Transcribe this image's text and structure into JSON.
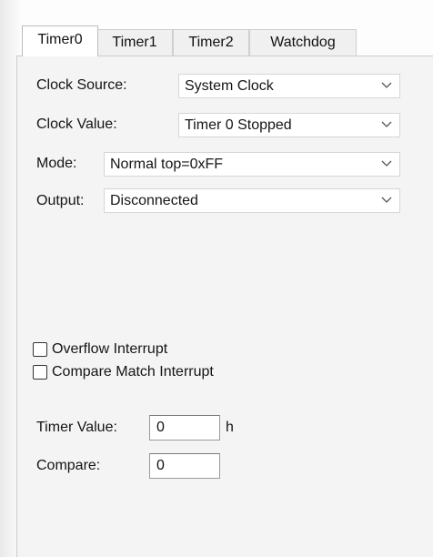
{
  "tabs": [
    {
      "label": "Timer0",
      "active": true
    },
    {
      "label": "Timer1",
      "active": false
    },
    {
      "label": "Timer2",
      "active": false
    },
    {
      "label": "Watchdog",
      "active": false
    }
  ],
  "clock_source": {
    "label": "Clock Source:",
    "value": "System Clock"
  },
  "clock_value": {
    "label": "Clock Value:",
    "value": "Timer 0 Stopped"
  },
  "mode": {
    "label": "Mode:",
    "value": "Normal top=0xFF"
  },
  "output": {
    "label": "Output:",
    "value": "Disconnected"
  },
  "overflow_interrupt": {
    "label": "Overflow Interrupt",
    "checked": false
  },
  "compare_match_interrupt": {
    "label": "Compare Match Interrupt",
    "checked": false
  },
  "timer_value": {
    "label": "Timer Value:",
    "value": "0",
    "unit": "h"
  },
  "compare": {
    "label": "Compare:",
    "value": "0"
  },
  "colors": {
    "panel": "#f4f4f4",
    "active_tab": "#ffffff",
    "inactive_tab": "#f0f0f0",
    "border": "#cdcdcd"
  }
}
